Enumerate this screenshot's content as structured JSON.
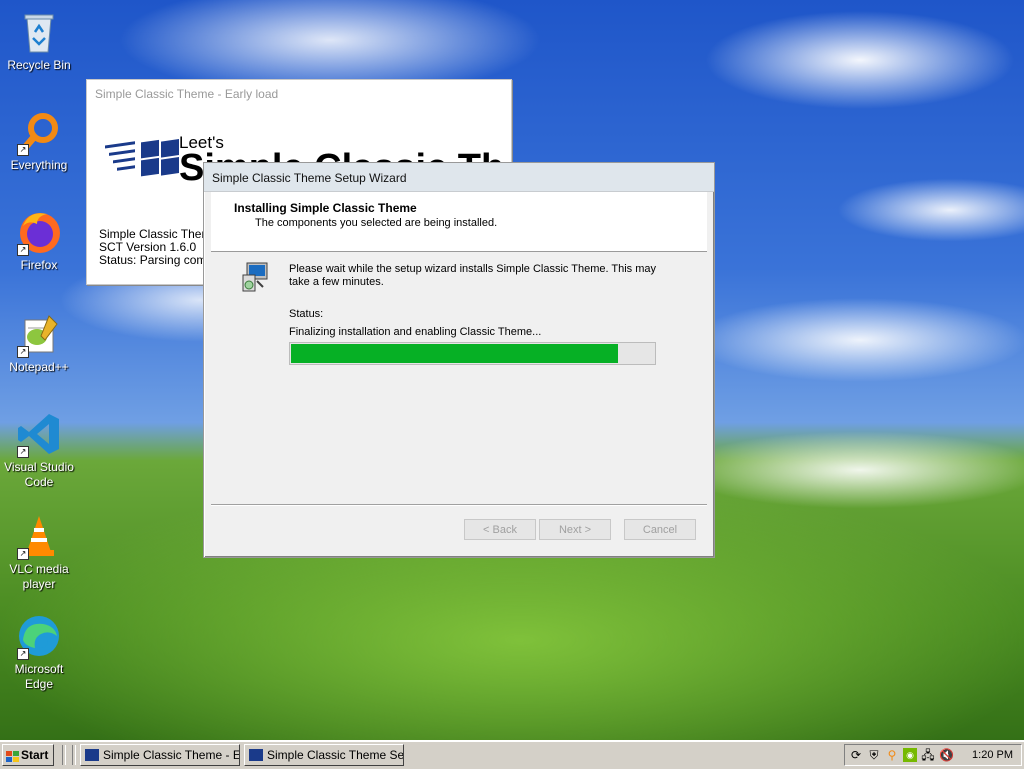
{
  "desktop": {
    "icons": [
      {
        "label": "Recycle Bin"
      },
      {
        "label": "Everything"
      },
      {
        "label": "Firefox"
      },
      {
        "label": "Notepad++"
      },
      {
        "label": "Visual Studio\nCode"
      },
      {
        "label": "VLC media\nplayer"
      },
      {
        "label": "Microsoft\nEdge"
      }
    ]
  },
  "early_load": {
    "title": "Simple Classic Theme - Early load",
    "logo_line1": "Leet's",
    "logo_line2": "Simple Classic Theme",
    "info_line1": "Simple Classic Theme",
    "info_line2": "SCT Version 1.6.0",
    "info_line3": "Status: Parsing comma"
  },
  "wizard": {
    "title": "Simple Classic Theme Setup Wizard",
    "heading": "Installing Simple Classic Theme",
    "subheading": "The components you selected are being installed.",
    "wait_text": "Please wait while the setup wizard installs Simple Classic Theme. This may take a few minutes.",
    "status_label": "Status:",
    "status_text": "Finalizing installation and enabling Classic Theme...",
    "progress": 0.9,
    "buttons": {
      "back": "< Back",
      "next": "Next >",
      "cancel": "Cancel"
    }
  },
  "taskbar": {
    "start_label": "Start",
    "tasks": [
      {
        "label": "Simple Classic Theme - Ea..."
      },
      {
        "label": "Simple Classic Theme Set..."
      }
    ],
    "clock": "1:20 PM"
  },
  "colors": {
    "progress_fill": "#06b025",
    "taskbar": "#d4d0c8"
  }
}
